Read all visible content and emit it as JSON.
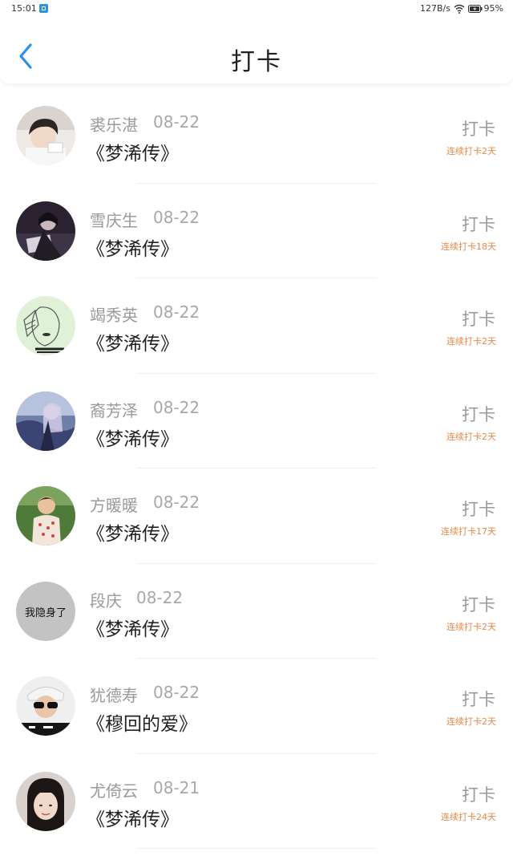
{
  "status_bar": {
    "time": "15:01",
    "speed": "127B/s",
    "battery": "95%",
    "notification_icon": "app-notification-icon",
    "wifi_icon": "wifi-icon",
    "battery_icon": "battery-charging-icon"
  },
  "header": {
    "title": "打卡",
    "back_icon": "chevron-left-icon"
  },
  "colors": {
    "accent_blue": "#2f8fe0",
    "streak_orange": "#e58846",
    "name_gray": "#9a9a9a"
  },
  "checkins": [
    {
      "name": "裘乐湛",
      "date": "08-22",
      "book": "《梦浠传》",
      "action": "打卡",
      "streak": "连续打卡2天"
    },
    {
      "name": "雪庆生",
      "date": "08-22",
      "book": "《梦浠传》",
      "action": "打卡",
      "streak": "连续打卡18天"
    },
    {
      "name": "竭秀英",
      "date": "08-22",
      "book": "《梦浠传》",
      "action": "打卡",
      "streak": "连续打卡2天"
    },
    {
      "name": "裔芳泽",
      "date": "08-22",
      "book": "《梦浠传》",
      "action": "打卡",
      "streak": "连续打卡2天"
    },
    {
      "name": "方暖暖",
      "date": "08-22",
      "book": "《梦浠传》",
      "action": "打卡",
      "streak": "连续打卡17天"
    },
    {
      "name": "段庆",
      "date": "08-22",
      "book": "《梦浠传》",
      "action": "打卡",
      "streak": "连续打卡2天",
      "avatar_text": "我隐身了"
    },
    {
      "name": "犹德寿",
      "date": "08-22",
      "book": "《穆回的爱》",
      "action": "打卡",
      "streak": "连续打卡2天"
    },
    {
      "name": "尤倚云",
      "date": "08-21",
      "book": "《梦浠传》",
      "action": "打卡",
      "streak": "连续打卡24天"
    }
  ]
}
